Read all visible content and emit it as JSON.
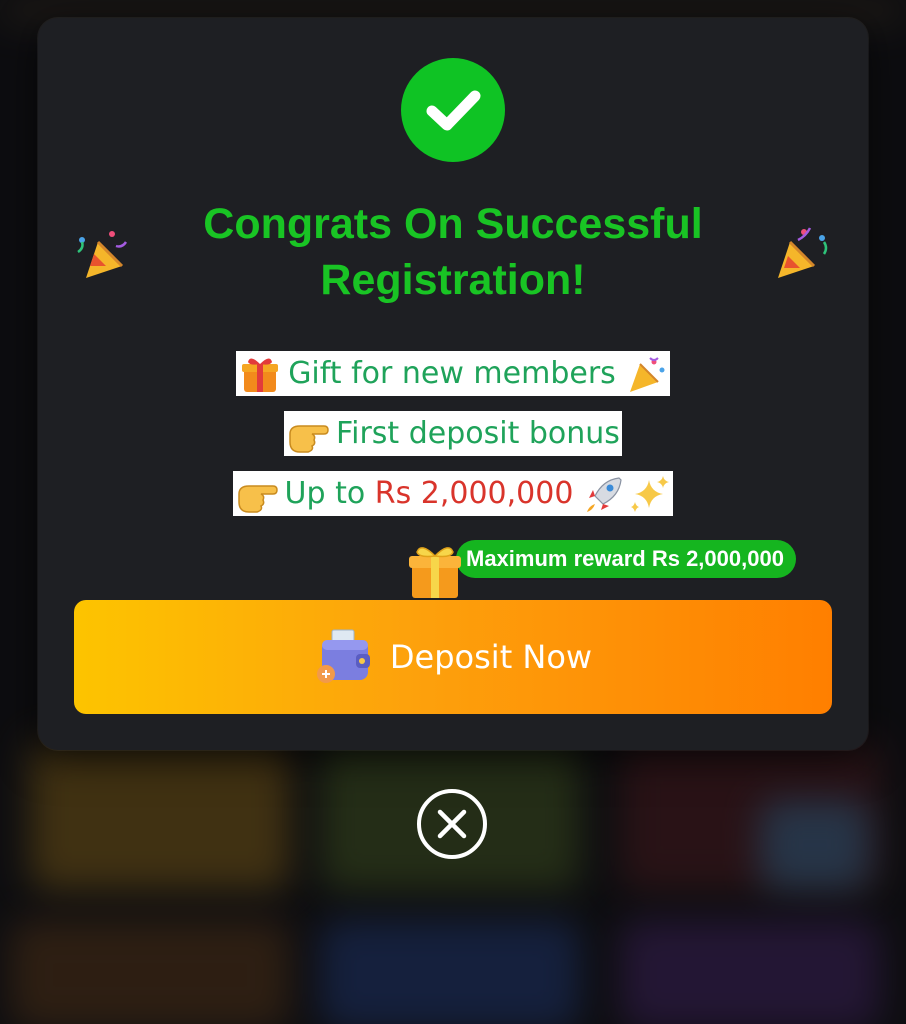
{
  "modal": {
    "title": "Congrats On Successful Registration!",
    "promo_lines": [
      {
        "text": "Gift for new members",
        "icon": "gift-icon",
        "trailing_icon": "party-popper-icon"
      },
      {
        "text": "First deposit bonus",
        "icon": "pointing-hand-icon"
      },
      {
        "prefix": "Up to ",
        "amount": "Rs 2,000,000",
        "icon": "pointing-hand-icon",
        "trailing_icons": [
          "rocket-icon",
          "sparkles-icon"
        ]
      }
    ],
    "reward_badge": "Maximum reward Rs 2,000,000",
    "deposit_button_label": "Deposit Now",
    "close_icon": "close-icon",
    "success_icon": "checkmark-icon"
  },
  "colors": {
    "success_green": "#0fc324",
    "title_green": "#19c424",
    "promo_text_green": "#1fa35a",
    "amount_red": "#d9342b",
    "button_gradient_start": "#fdc400",
    "button_gradient_end": "#ff7f00",
    "modal_background": "#1e1f23"
  }
}
